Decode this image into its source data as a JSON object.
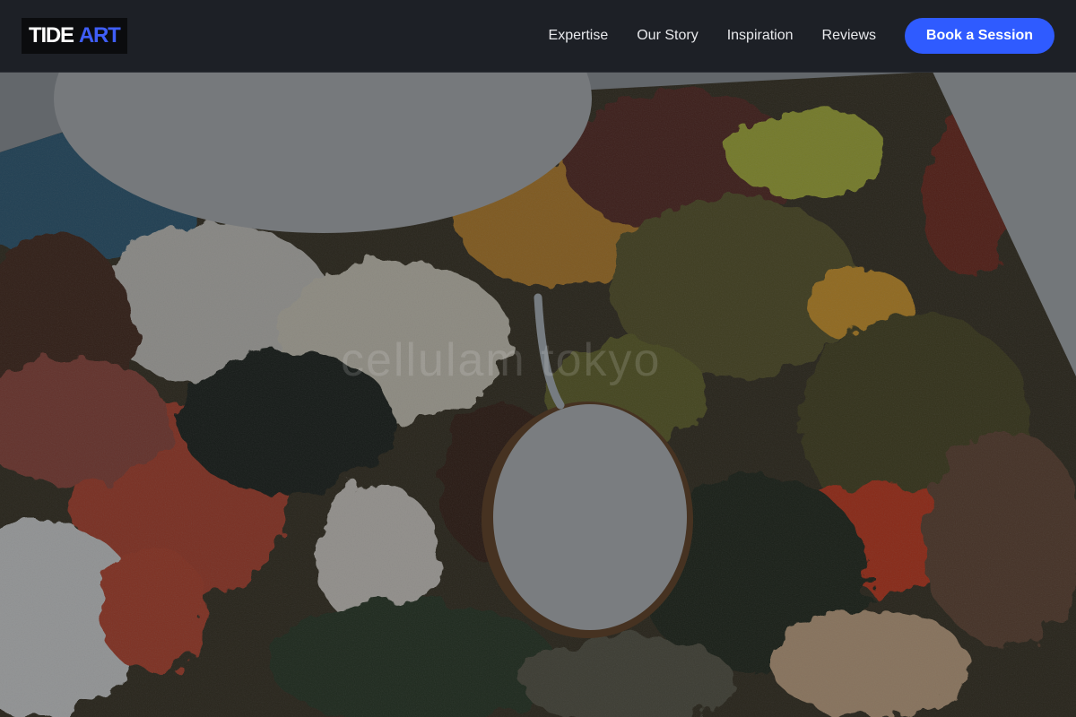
{
  "brand": {
    "logo_part1": "TIDE",
    "logo_part2": "ART",
    "accent_color": "#2f5bff"
  },
  "nav": {
    "links": [
      "Expertise",
      "Our Story",
      "Inspiration",
      "Reviews"
    ],
    "cta_label": "Book a Session"
  },
  "hero": {
    "image_subject": "paint-covered artist palette",
    "watermark_text": "cellulam tokyo"
  }
}
